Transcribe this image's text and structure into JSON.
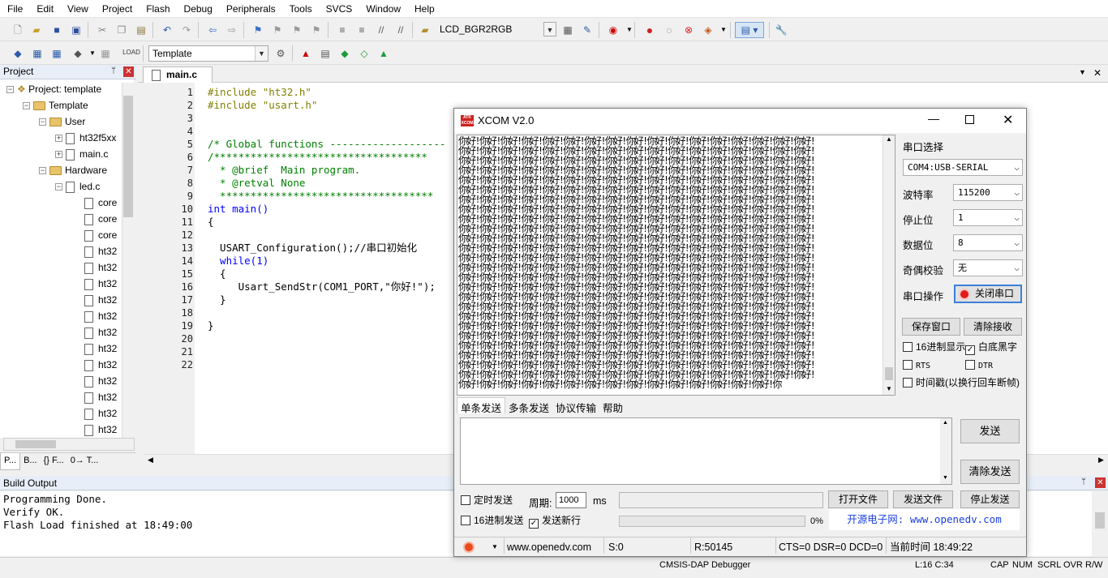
{
  "menu": [
    "File",
    "Edit",
    "View",
    "Project",
    "Flash",
    "Debug",
    "Peripherals",
    "Tools",
    "SVCS",
    "Window",
    "Help"
  ],
  "toolbar": {
    "target_combo": "LCD_BGR2RGB",
    "build_target": "Template"
  },
  "project_panel": {
    "title": "Project",
    "root": "Project: template",
    "target": "Template",
    "groups": [
      {
        "name": "User",
        "files": [
          "ht32f5xx",
          "main.c"
        ]
      },
      {
        "name": "Hardware",
        "files": [
          "led.c"
        ]
      }
    ],
    "led_children": [
      "core",
      "core",
      "core",
      "ht32",
      "ht32",
      "ht32",
      "ht32",
      "ht32",
      "ht32",
      "ht32",
      "ht32",
      "ht32",
      "ht32",
      "ht32",
      "ht32"
    ],
    "bottom_tabs": [
      "P...",
      "B...",
      "{} F...",
      "0→ T..."
    ]
  },
  "editor": {
    "tab": "main.c",
    "line_numbers": [
      "1",
      "2",
      "3",
      "4",
      "5",
      "6",
      "7",
      "8",
      "9",
      "10",
      "11",
      "12",
      "13",
      "14",
      "15",
      "16",
      "17",
      "18",
      "19",
      "20",
      "21",
      "22"
    ],
    "lines": [
      "#include \"ht32.h\"",
      "#include \"usart.h\"",
      "",
      "",
      "/* Global functions -------------------",
      "/***********************************",
      "  * @brief  Main program.",
      "  * @retval None",
      "  ***********************************",
      "int main()",
      "{",
      "",
      "  USART_Configuration();//串口初始化",
      "  while(1)",
      "  {",
      "     Usart_SendStr(COM1_PORT,\"你好!\");",
      "  }",
      "",
      "}",
      "",
      "",
      ""
    ]
  },
  "build_output": {
    "title": "Build Output",
    "lines": [
      "Programming Done.",
      "Verify OK.",
      "Flash Load finished at 18:49:00"
    ]
  },
  "statusbar": {
    "debugger": "CMSIS-DAP Debugger",
    "position": "L:16 C:34",
    "flags": [
      "CAP",
      "NUM",
      "SCRL",
      "OVR",
      "R/W"
    ]
  },
  "xcom": {
    "title": "XCOM V2.0",
    "logo": "ATK XCOM",
    "rx_unit": "你好!",
    "rx_lines": 26,
    "rx_units_per_line": 17,
    "rx_last_line": "你好!你好!你好!你好!你好!你好!你好!你好!你好!你好!你好!你好!你好!你好!你好!你",
    "serial_select_label": "串口选择",
    "port": "COM4:USB-SERIAL",
    "baud_label": "波特率",
    "baud": "115200",
    "stop_label": "停止位",
    "stop": "1",
    "data_label": "数据位",
    "data": "8",
    "parity_label": "奇偶校验",
    "parity": "无",
    "op_label": "串口操作",
    "close_port": "关闭串口",
    "save_window": "保存窗口",
    "clear_rx": "清除接收",
    "hex_display": "16进制显示",
    "white_black": "白底黑字",
    "rts": "RTS",
    "dtr": "DTR",
    "timestamp": "时间戳(以换行回车断帧)",
    "tabs": [
      "单条发送",
      "多条发送",
      "协议传输",
      "帮助"
    ],
    "send": "发送",
    "clear_send": "清除发送",
    "timed_send": "定时发送",
    "period_label": "周期:",
    "period": "1000",
    "ms": "ms",
    "open_file": "打开文件",
    "send_file": "发送文件",
    "stop_send": "停止发送",
    "hex_send": "16进制发送",
    "send_newline": "发送新行",
    "progress": "0%",
    "promo": "开源电子网: www.openedv.com",
    "status_site": "www.openedv.com",
    "status_s": "S:0",
    "status_r": "R:50145",
    "status_lines": "CTS=0 DSR=0 DCD=0",
    "status_time": "当前时间 18:49:22"
  }
}
